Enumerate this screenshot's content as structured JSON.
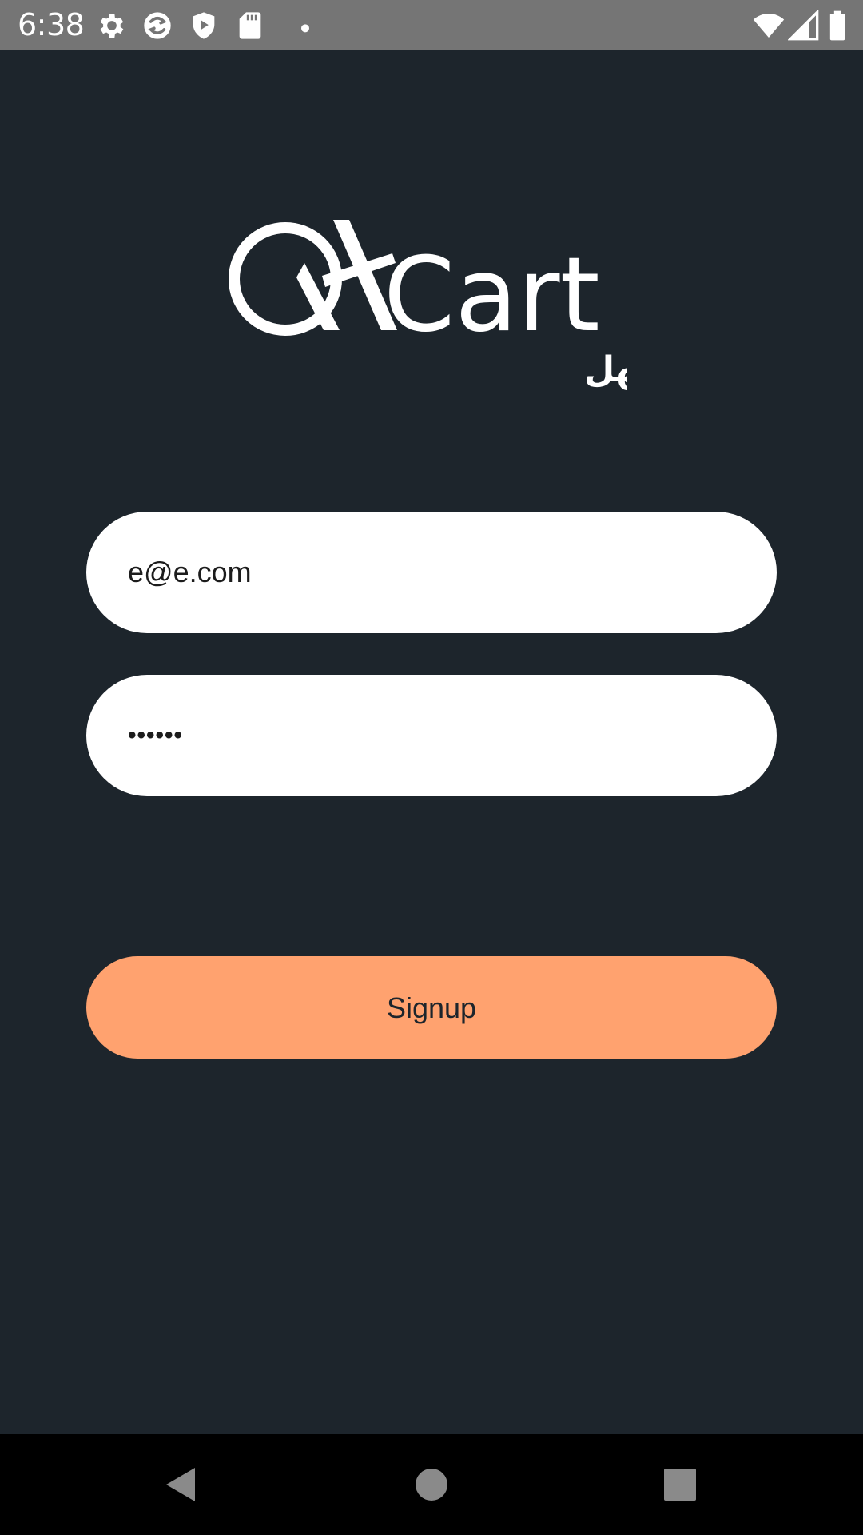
{
  "status_bar": {
    "time": "6:38",
    "background": "#757575",
    "left_icons": [
      "gear-icon",
      "refresh-app-icon",
      "shield-play-icon",
      "sd-card-icon",
      "notification-dot-icon"
    ],
    "right_icons": [
      "wifi-icon",
      "cellular-signal-icon",
      "battery-icon"
    ]
  },
  "app": {
    "background": "#1d252c",
    "logo": {
      "wordmark": "Cart",
      "tagline": "بالعربي أسهل"
    },
    "email_field": {
      "value": "e@e.com"
    },
    "password_field": {
      "value": "••••••"
    },
    "signup_button": {
      "label": "Signup",
      "color": "#ffa26f"
    }
  },
  "nav_bar": {
    "background": "#000000",
    "buttons": [
      "back-icon",
      "home-icon",
      "recents-icon"
    ]
  }
}
